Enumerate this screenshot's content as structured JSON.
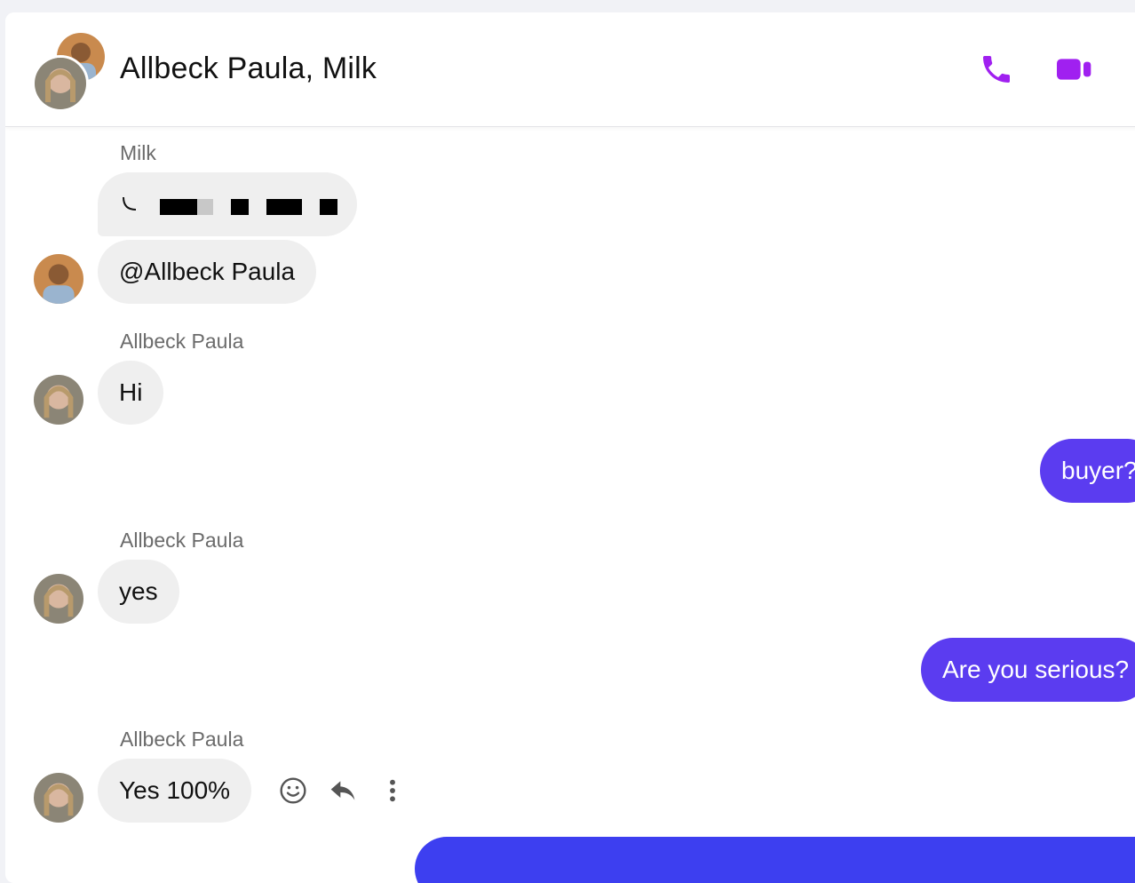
{
  "header": {
    "title": "Allbeck Paula, Milk",
    "call_icon": "phone-icon",
    "video_icon": "video-camera-icon",
    "accent_color": "#a020f0"
  },
  "messages": {
    "milk_sender": "Milk",
    "milk_mention": "@Allbeck Paula",
    "paula_sender_1": "Allbeck Paula",
    "paula_text_1": "Hi",
    "me_text_1": "buyer?",
    "paula_sender_2": "Allbeck Paula",
    "paula_text_2": "yes",
    "me_text_2": "Are you serious?",
    "paula_sender_3": "Allbeck Paula",
    "paula_text_3": "Yes 100%"
  },
  "actions": {
    "emoji_icon": "smiley-icon",
    "reply_icon": "reply-icon",
    "more_icon": "more-vertical-icon"
  },
  "colors": {
    "own_bubble": "#5b3cf0",
    "other_bubble": "#efefef"
  }
}
